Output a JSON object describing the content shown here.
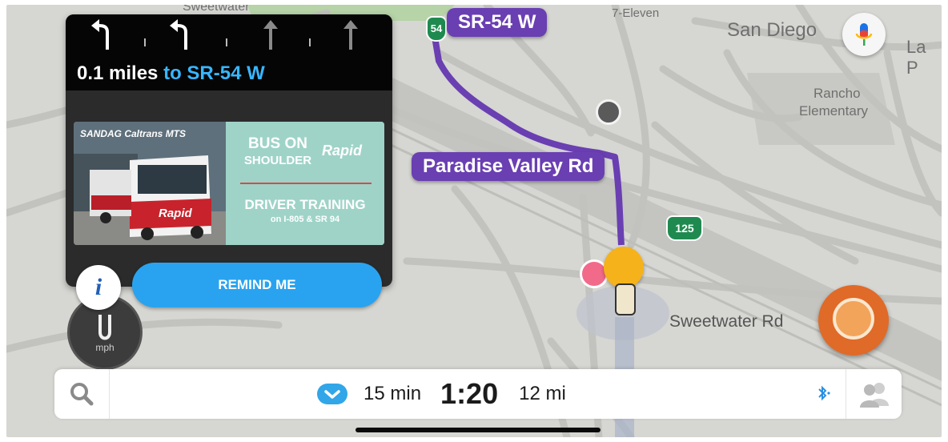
{
  "map": {
    "places": {
      "sweetwater_top": "Sweetwater",
      "seven_eleven": "7-Eleven",
      "san_diego": "San Diego",
      "la_p": "La P",
      "rancho": "Rancho",
      "elementary": "Elementary"
    },
    "route_labels": {
      "sr54w": "SR-54 W",
      "paradise": "Paradise Valley Rd"
    },
    "street_labels": {
      "sweetwater_rd": "Sweetwater Rd"
    },
    "shields": {
      "s125": "125",
      "s54": "54"
    },
    "colors": {
      "route": "#6a3fb2",
      "shield": "#1f8a4f",
      "road": "#c2c2be",
      "background": "#d6d6d2"
    }
  },
  "nav": {
    "lanes": [
      "turn-left-arrow",
      "turn-left-arrow",
      "straight-arrow",
      "straight-arrow"
    ],
    "distance": "0.1 miles",
    "connector": "to",
    "road": "SR-54 W"
  },
  "ad": {
    "brands": "SANDAG  Caltrans  MTS",
    "headline_1": "BUS ON",
    "headline_2": "SHOULDER",
    "rapid": "Rapid",
    "headline_3": "DRIVER TRAINING",
    "headline_4": "on I-805 & SR 94",
    "bus_sign": "Rapid",
    "button": "REMIND ME"
  },
  "speedometer": {
    "value": "0",
    "unit": "mph"
  },
  "eta_bar": {
    "duration": "15 min",
    "arrival": "1:20",
    "distance": "12 mi"
  },
  "icons": {
    "search": "search-icon",
    "chevron": "chevron-down-icon",
    "bluetooth": "bluetooth-icon",
    "friends": "friends-icon",
    "mic": "microphone-icon",
    "info": "info-icon"
  }
}
